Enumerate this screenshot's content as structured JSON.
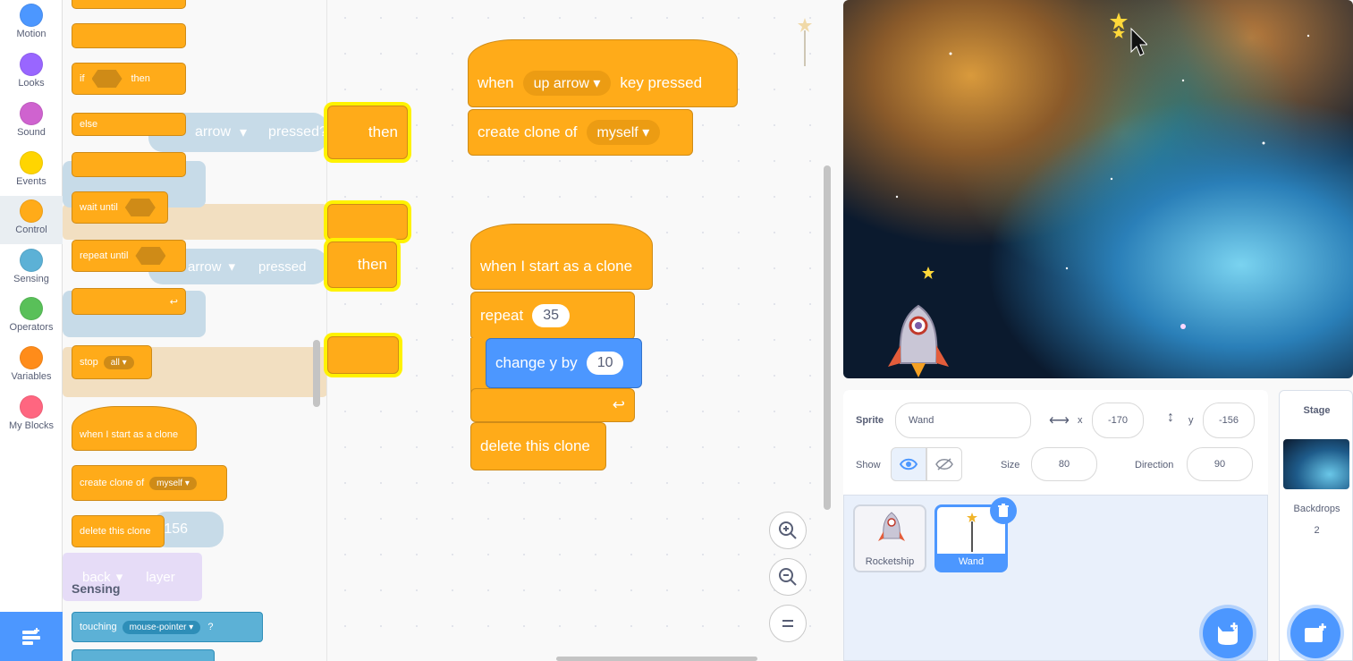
{
  "categories": [
    {
      "label": "Motion",
      "color": "#4c97ff"
    },
    {
      "label": "Looks",
      "color": "#9966ff"
    },
    {
      "label": "Sound",
      "color": "#cf63cf"
    },
    {
      "label": "Events",
      "color": "#ffd500"
    },
    {
      "label": "Control",
      "color": "#ffab19"
    },
    {
      "label": "Sensing",
      "color": "#5cb1d6"
    },
    {
      "label": "Operators",
      "color": "#59c059"
    },
    {
      "label": "Variables",
      "color": "#ff8c1a"
    },
    {
      "label": "My Blocks",
      "color": "#ff6680"
    }
  ],
  "palette": {
    "if_then": {
      "if": "if",
      "then": "then"
    },
    "else": "else",
    "wait_until": "wait until",
    "repeat_until": "repeat until",
    "stop": {
      "label": "stop",
      "option": "all"
    },
    "when_clone": "when I start as a clone",
    "create_clone": {
      "label": "create clone of",
      "option": "myself"
    },
    "delete_clone": "delete this clone",
    "section_sensing": "Sensing",
    "touching": {
      "label": "touching",
      "option": "mouse-pointer",
      "q": "?"
    },
    "ghost": {
      "arrow": "arrow",
      "pressed_q": "pressed?",
      "then1": "then",
      "arrow2": "arrow",
      "pressed_2": "pressed",
      "then2": "then",
      "val_156": "-156",
      "back": "back",
      "layer": "layer"
    }
  },
  "script": {
    "event_script": {
      "when": "when",
      "key": "up arrow",
      "key_pressed": "key pressed",
      "create_clone": "create clone of",
      "option": "myself"
    },
    "clone_script": {
      "hat": "when I start as a clone",
      "repeat": "repeat",
      "repeat_count": "35",
      "change_y": "change y by",
      "change_value": "10",
      "delete": "delete this clone"
    }
  },
  "sprite_info": {
    "sprite_label": "Sprite",
    "sprite_name": "Wand",
    "x_label": "x",
    "x_value": "-170",
    "y_label": "y",
    "y_value": "-156",
    "show_label": "Show",
    "size_label": "Size",
    "size_value": "80",
    "direction_label": "Direction",
    "direction_value": "90"
  },
  "sprites": [
    {
      "name": "Rocketship",
      "selected": false
    },
    {
      "name": "Wand",
      "selected": true
    }
  ],
  "stage_pane": {
    "title": "Stage",
    "backdrops_label": "Backdrops",
    "backdrops_count": "2"
  },
  "colors": {
    "control": "#ffab19",
    "motion": "#4c97ff",
    "sensing": "#5cb1d6",
    "accent": "#4c97ff"
  }
}
